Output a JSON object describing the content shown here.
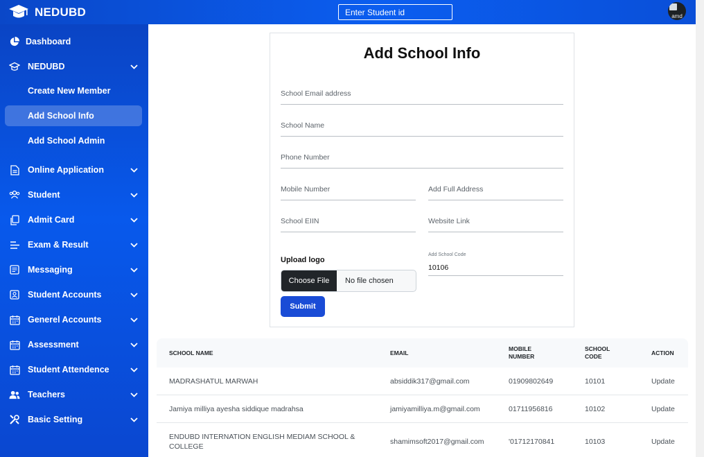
{
  "header": {
    "brand": "NEDUBD",
    "search_placeholder": "Enter Student id",
    "avatar_alt": "amd"
  },
  "sidebar": {
    "items": [
      {
        "label": "Dashboard",
        "icon": "pie-chart-icon"
      },
      {
        "label": "NEDUBD",
        "icon": "graduation-cap-icon",
        "expanded": true,
        "children": [
          {
            "label": "Create New Member"
          },
          {
            "label": "Add School Info",
            "active": true
          },
          {
            "label": "Add School Admin"
          }
        ]
      },
      {
        "label": "Online Application",
        "icon": "document-icon"
      },
      {
        "label": "Student",
        "icon": "users-icon"
      },
      {
        "label": "Admit Card",
        "icon": "card-copy-icon"
      },
      {
        "label": "Exam & Result",
        "icon": "align-left-icon"
      },
      {
        "label": "Messaging",
        "icon": "message-list-icon"
      },
      {
        "label": "Student Accounts",
        "icon": "account-box-icon"
      },
      {
        "label": "Generel Accounts",
        "icon": "calendar-icon"
      },
      {
        "label": "Assessment",
        "icon": "calendar-icon"
      },
      {
        "label": "Student Attendence",
        "icon": "calendar-icon"
      },
      {
        "label": "Teachers",
        "icon": "users-icon"
      },
      {
        "label": "Basic Setting",
        "icon": "tools-icon"
      }
    ]
  },
  "form": {
    "title": "Add School Info",
    "email_placeholder": "School Email address",
    "name_placeholder": "School Name",
    "phone_placeholder": "Phone Number",
    "mobile_placeholder": "Mobile Number",
    "address_placeholder": "Add Full Address",
    "eiin_placeholder": "School EIIN",
    "website_placeholder": "Website Link",
    "upload_label": "Upload logo",
    "choose_file": "Choose File",
    "no_file": "No file chosen",
    "code_label": "Add School Code",
    "code_value": "10106",
    "submit_label": "Submit"
  },
  "table": {
    "headers": {
      "name": "SCHOOL NAME",
      "email": "EMAIL",
      "mobile": "MOBILE NUMBER",
      "code": "SCHOOL CODE",
      "action": "ACTION"
    },
    "rows": [
      {
        "name": "MADRASHATUL MARWAH",
        "email": "absiddik317@gmail.com",
        "mobile": "01909802649",
        "code": "10101",
        "action": "Update"
      },
      {
        "name": "Jamiya milliya ayesha siddique madrahsa",
        "email": "jamiyamilliya.m@gmail.com",
        "mobile": "01711956816",
        "code": "10102",
        "action": "Update"
      },
      {
        "name": "ENDUBD INTERNATION ENGLISH MEDIAM SCHOOL & COLLEGE",
        "email": "shamimsoft2017@gmail.com",
        "mobile": "'01712170841",
        "code": "10103",
        "action": "Update"
      }
    ]
  },
  "colors": {
    "sidebar": "#0859ec",
    "topbar": "#0b5ef0",
    "submit": "#1a4cd6"
  }
}
